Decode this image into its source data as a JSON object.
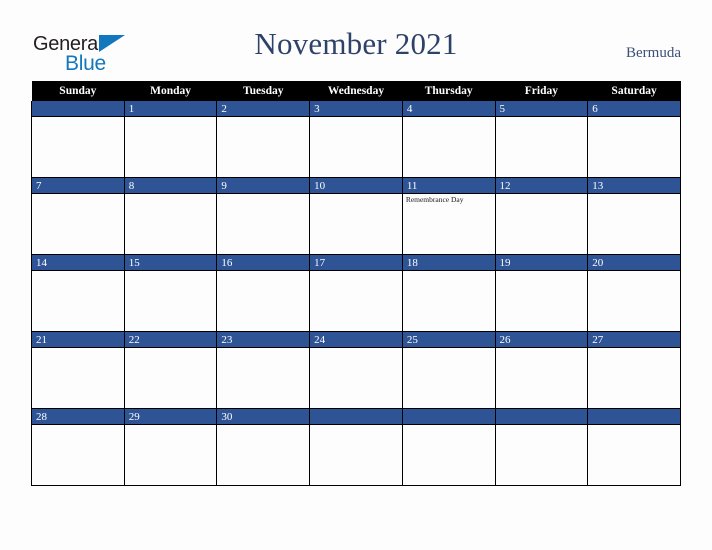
{
  "brand": {
    "word_top": "General",
    "word_bottom": "Blue",
    "triangle_icon": "triangle-icon",
    "color_dark": "#231f20",
    "color_blue": "#1277bd"
  },
  "header": {
    "title": "November 2021",
    "country": "Bermuda",
    "title_color": "#2e4269",
    "country_color": "#3c5077"
  },
  "calendar": {
    "weekday_headers": [
      "Sunday",
      "Monday",
      "Tuesday",
      "Wednesday",
      "Thursday",
      "Friday",
      "Saturday"
    ],
    "header_bg": "#000000",
    "daybar_bg": "#2f5496",
    "cell_bg": "#fdfdfd",
    "weeks": [
      [
        {
          "day": "",
          "events": []
        },
        {
          "day": "1",
          "events": []
        },
        {
          "day": "2",
          "events": []
        },
        {
          "day": "3",
          "events": []
        },
        {
          "day": "4",
          "events": []
        },
        {
          "day": "5",
          "events": []
        },
        {
          "day": "6",
          "events": []
        }
      ],
      [
        {
          "day": "7",
          "events": []
        },
        {
          "day": "8",
          "events": []
        },
        {
          "day": "9",
          "events": []
        },
        {
          "day": "10",
          "events": []
        },
        {
          "day": "11",
          "events": [
            "Remembrance Day"
          ]
        },
        {
          "day": "12",
          "events": []
        },
        {
          "day": "13",
          "events": []
        }
      ],
      [
        {
          "day": "14",
          "events": []
        },
        {
          "day": "15",
          "events": []
        },
        {
          "day": "16",
          "events": []
        },
        {
          "day": "17",
          "events": []
        },
        {
          "day": "18",
          "events": []
        },
        {
          "day": "19",
          "events": []
        },
        {
          "day": "20",
          "events": []
        }
      ],
      [
        {
          "day": "21",
          "events": []
        },
        {
          "day": "22",
          "events": []
        },
        {
          "day": "23",
          "events": []
        },
        {
          "day": "24",
          "events": []
        },
        {
          "day": "25",
          "events": []
        },
        {
          "day": "26",
          "events": []
        },
        {
          "day": "27",
          "events": []
        }
      ],
      [
        {
          "day": "28",
          "events": []
        },
        {
          "day": "29",
          "events": []
        },
        {
          "day": "30",
          "events": []
        },
        {
          "day": "",
          "events": []
        },
        {
          "day": "",
          "events": []
        },
        {
          "day": "",
          "events": []
        },
        {
          "day": "",
          "events": []
        }
      ]
    ]
  }
}
